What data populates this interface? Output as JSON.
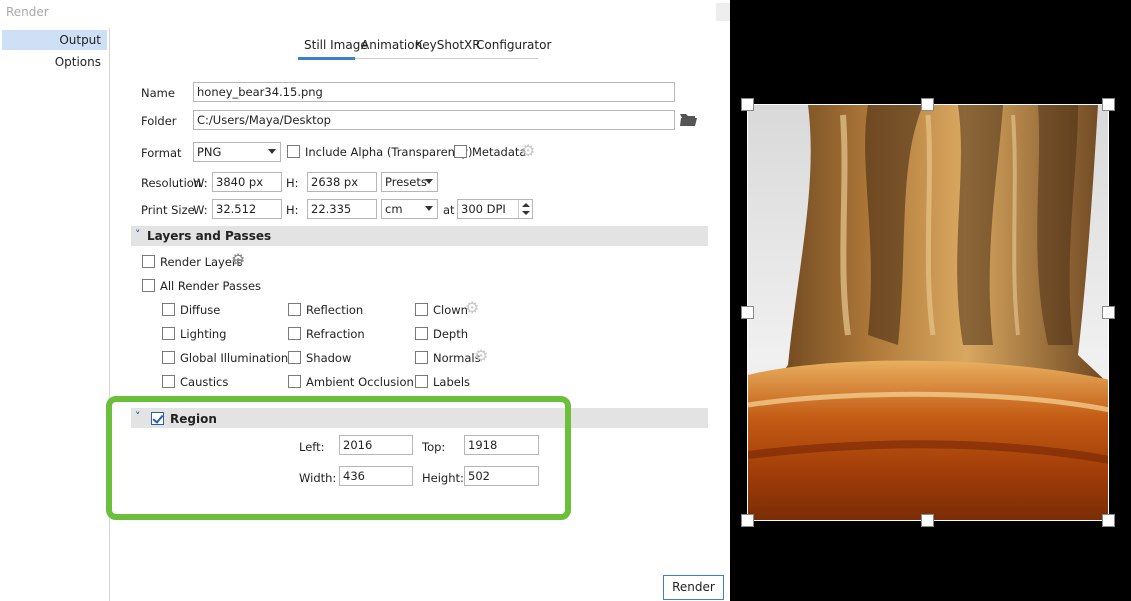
{
  "window": {
    "title": "Render"
  },
  "sidebar": {
    "items": [
      {
        "label": "Output"
      },
      {
        "label": "Options"
      }
    ]
  },
  "tabs": [
    {
      "label": "Still Image"
    },
    {
      "label": "Animation"
    },
    {
      "label": "KeyShotXR"
    },
    {
      "label": "Configurator"
    }
  ],
  "output": {
    "name_label": "Name",
    "name_value": "honey_bear34.15.png",
    "folder_label": "Folder",
    "folder_value": "C:/Users/Maya/Desktop",
    "format_label": "Format",
    "format_value": "PNG",
    "include_alpha_label": "Include Alpha (Transparency)",
    "metadata_label": "Metadata",
    "resolution_label": "Resolution",
    "w_label": "W:",
    "h_label": "H:",
    "res_w": "3840 px",
    "res_h": "2638 px",
    "presets_label": "Presets",
    "print_size_label": "Print Size",
    "print_w": "32.512",
    "print_h": "22.335",
    "print_unit": "cm",
    "at_label": "at",
    "dpi_value": "300 DPI"
  },
  "layers": {
    "title": "Layers and Passes",
    "render_layers_label": "Render Layers",
    "all_passes_label": "All Render Passes",
    "passes": {
      "diffuse": "Diffuse",
      "lighting": "Lighting",
      "global_illumination": "Global Illumination",
      "caustics": "Caustics",
      "reflection": "Reflection",
      "refraction": "Refraction",
      "shadow": "Shadow",
      "ambient_occlusion": "Ambient Occlusion",
      "clown": "Clown",
      "depth": "Depth",
      "normals": "Normals",
      "labels": "Labels"
    }
  },
  "region": {
    "title": "Region",
    "enabled": true,
    "left_label": "Left:",
    "left_value": "2016",
    "top_label": "Top:",
    "top_value": "1918",
    "width_label": "Width:",
    "width_value": "436",
    "height_label": "Height:",
    "height_value": "502"
  },
  "actions": {
    "render_label": "Render"
  },
  "colors": {
    "highlight": "#6cbf3a",
    "accent": "#3b7fd0"
  }
}
